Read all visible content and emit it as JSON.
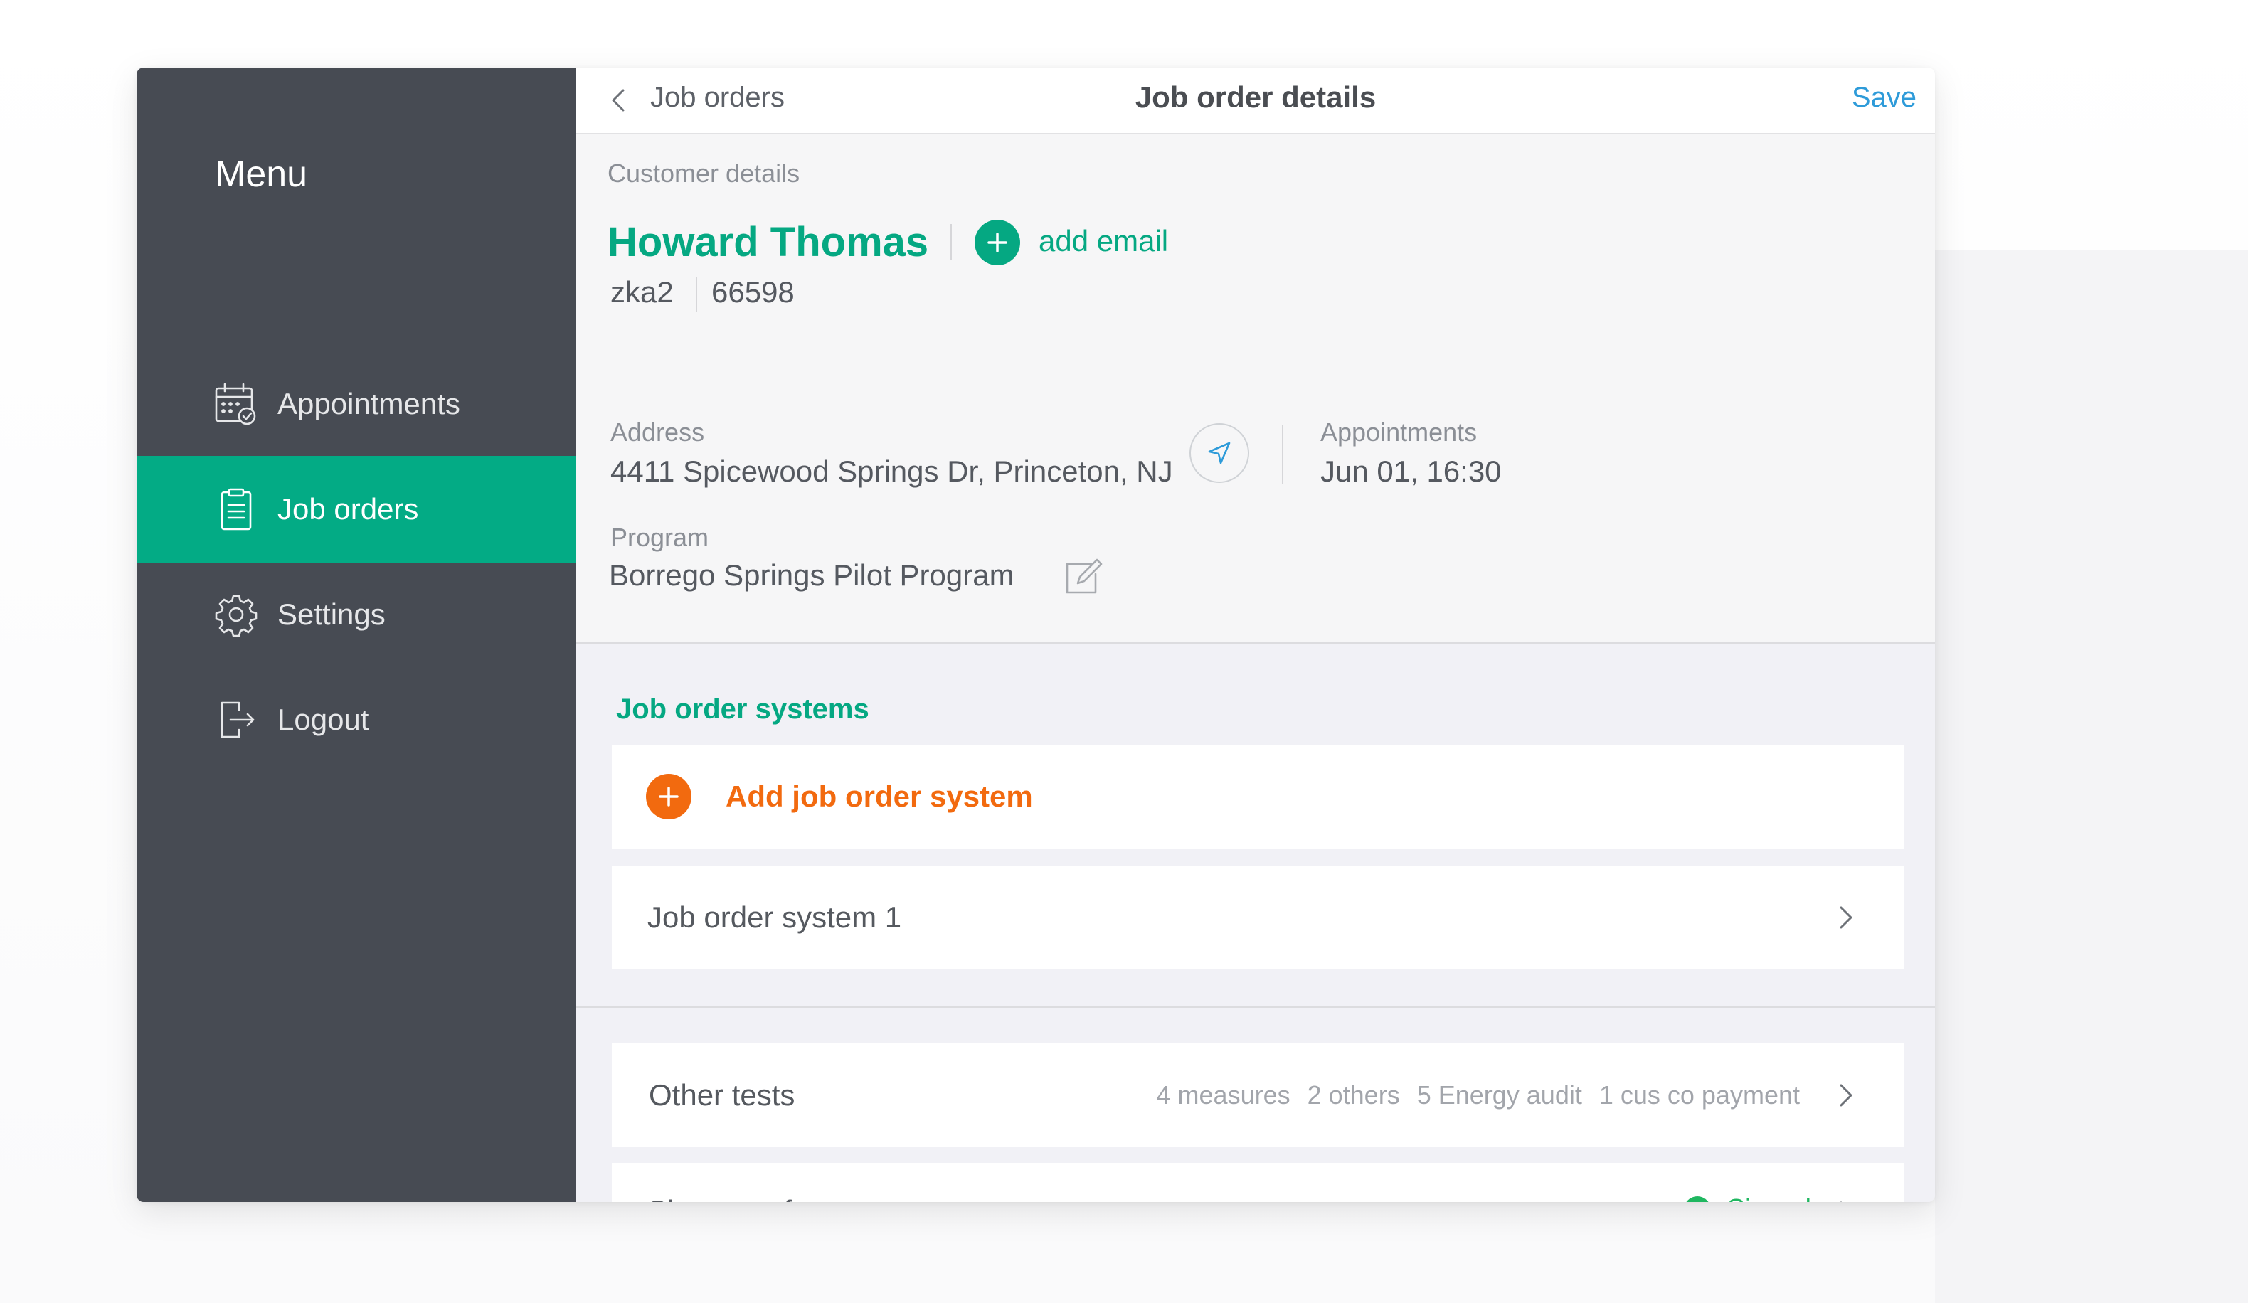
{
  "sidebar": {
    "title": "Menu",
    "items": [
      {
        "label": "Appointments",
        "icon": "calendar-check-icon",
        "active": false
      },
      {
        "label": "Job orders",
        "icon": "clipboard-icon",
        "active": true
      },
      {
        "label": "Settings",
        "icon": "gear-icon",
        "active": false
      },
      {
        "label": "Logout",
        "icon": "logout-icon",
        "active": false
      }
    ]
  },
  "header": {
    "back_label": "Job orders",
    "title": "Job order details",
    "save_label": "Save"
  },
  "customer": {
    "section_label": "Customer details",
    "name": "Howard Thomas",
    "add_email_label": "add email",
    "code": "zka2",
    "number": "66598",
    "address_label": "Address",
    "address": "4411 Spicewood Springs Dr, Princeton, NJ",
    "appointments_label": "Appointments",
    "appointment": "Jun 01, 16:30",
    "program_label": "Program",
    "program": "Borrego Springs Pilot Program"
  },
  "systems": {
    "title": "Job order systems",
    "add_label": "Add job order system",
    "items": [
      {
        "label": "Job order system 1"
      }
    ]
  },
  "other_tests": {
    "label": "Other tests",
    "summary": [
      "4 measures",
      "2 others",
      "5 Energy audit",
      "1 cus co payment"
    ]
  },
  "signature": {
    "label": "Signature form",
    "status": "Signed"
  },
  "colors": {
    "accent": "#05a882",
    "orange": "#f26a0f",
    "sidebar": "#474b53",
    "link": "#2e9bd9",
    "success": "#1fb760"
  }
}
